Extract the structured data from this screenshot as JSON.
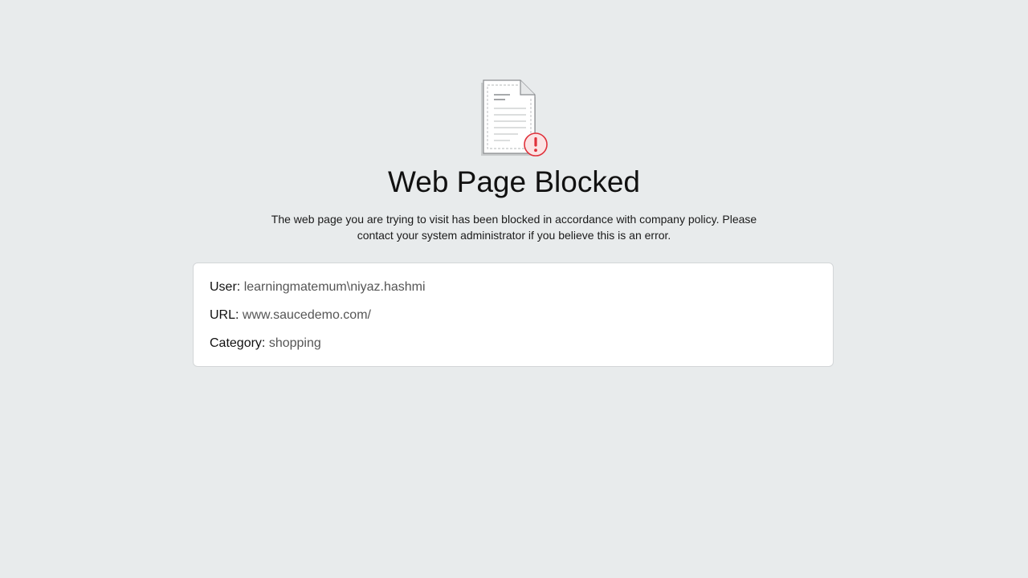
{
  "page": {
    "title": "Web Page Blocked",
    "message": "The web page you are trying to visit has been blocked in accordance with company policy. Please contact your system administrator if you believe this is an error."
  },
  "icon": {
    "name": "blocked-document-icon",
    "alert_color": "#e0303a"
  },
  "details": {
    "user": {
      "label": "User:",
      "value": "learningmatemum\\niyaz.hashmi"
    },
    "url": {
      "label": "URL:",
      "value": "www.saucedemo.com/"
    },
    "category": {
      "label": "Category:",
      "value": "shopping"
    }
  },
  "colors": {
    "background": "#e8ebec",
    "card": "#ffffff",
    "value_text": "#555555"
  }
}
